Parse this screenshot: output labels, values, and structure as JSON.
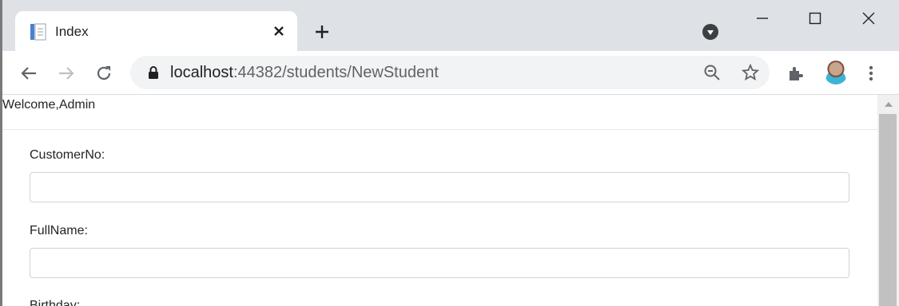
{
  "browser": {
    "tab": {
      "title": "Index",
      "favicon": "document-icon"
    },
    "address": {
      "host": "localhost",
      "path": ":44382/students/NewStudent"
    }
  },
  "page": {
    "welcome": "Welcome,Admin",
    "form": {
      "customer_no_label": "CustomerNo:",
      "customer_no_value": "",
      "full_name_label": "FullName:",
      "full_name_value": "",
      "birthday_label": "Birthday:"
    }
  },
  "colors": {
    "tabstrip": "#dee1e6",
    "omnibox": "#f1f3f4",
    "page_bg": "#ffffff"
  }
}
